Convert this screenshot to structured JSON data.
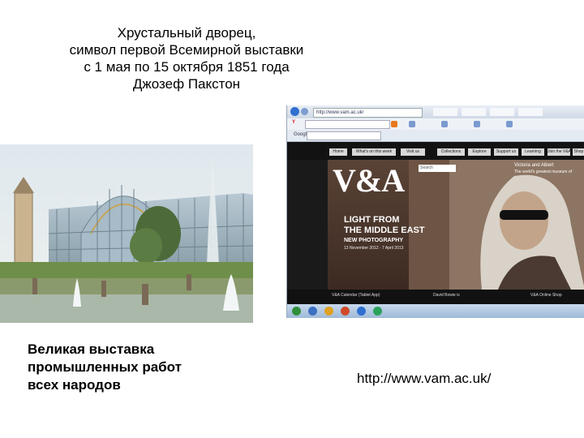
{
  "slide": {
    "title_lines": [
      "Хрустальный дворец,",
      "символ первой Всемирной выставки",
      "с 1 мая по 15 октября 1851 года",
      "Джозеф Пакстон"
    ],
    "left_caption_lines": [
      "Великая выставка",
      "промышленных работ",
      "всех народов"
    ],
    "url": "http://www.vam.ac.uk/"
  },
  "browser": {
    "address": "http://www.vam.ac.uk/",
    "search_placeholder": "Search",
    "google_label": "Google",
    "menu_logo": "Y",
    "nav": [
      "Home",
      "What's on this week",
      "Visit us",
      "Collections",
      "Explore",
      "Support us",
      "Learning",
      "Join the V&A",
      "Shop"
    ],
    "logo": "V&A",
    "tagline1": "Victoria and Albert",
    "tagline2": "The world's greatest museum of",
    "hero": {
      "line1": "LIGHT FROM",
      "line2": "THE MIDDLE EAST",
      "line3": "NEW PHOTOGRAPHY",
      "dates": "13 November 2012 - 7 April 2013"
    },
    "strip": [
      "V&A Calendar (Tablet App)",
      "David Bowie is",
      "V&A Online Shop"
    ]
  }
}
